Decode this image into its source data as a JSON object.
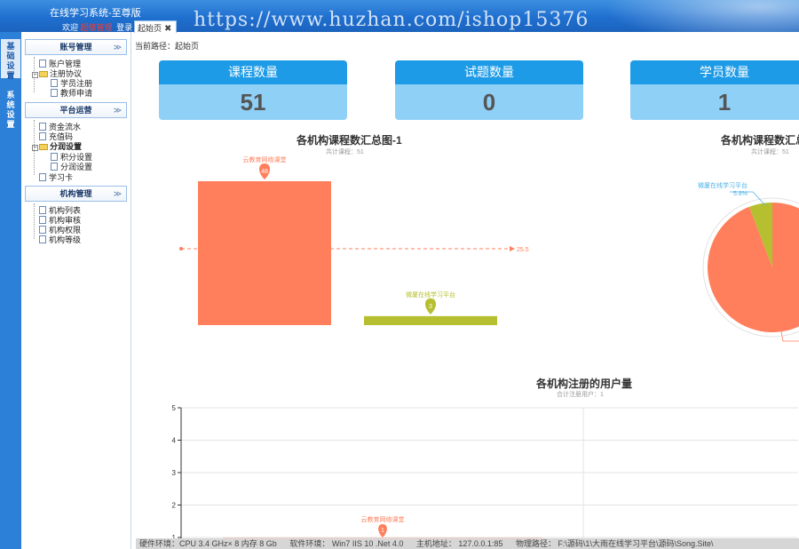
{
  "header": {
    "app_title": "在线学习系统-至尊版",
    "welcome_prefix": "欢迎",
    "admin_name": "超级管理",
    "login_label": "登录",
    "watermark": "https://www.huzhan.com/ishop15376"
  },
  "tabs": [
    {
      "label": "起始页",
      "close_icon": "close-icon"
    }
  ],
  "left_strip": {
    "items": [
      {
        "label": "基础设置",
        "active": true
      },
      {
        "label": "系统设置",
        "active": false
      }
    ]
  },
  "sidebar": {
    "panels": [
      {
        "title": "账号管理",
        "items": [
          "账户管理",
          "注册协议",
          "学员注册",
          "教师申请"
        ]
      },
      {
        "title": "平台运营",
        "items": [
          "资金流水",
          "充值码",
          "分润设置",
          "积分设置",
          "分润设置",
          "学习卡"
        ]
      },
      {
        "title": "机构管理",
        "items": [
          "机构列表",
          "机构审核",
          "机构权限",
          "机构等级"
        ]
      }
    ]
  },
  "breadcrumb": "当前路径：起始页",
  "stats": [
    {
      "label": "课程数量",
      "value": "51"
    },
    {
      "label": "试题数量",
      "value": "0"
    },
    {
      "label": "学员数量",
      "value": "1"
    }
  ],
  "colors": {
    "accent": "#1e9be6",
    "card_bottom": "#8fd0f7",
    "coral": "#ff7f5c",
    "olive": "#b5bf2f",
    "admin": "#ff3b30"
  },
  "charts": {
    "bar": {
      "title": "各机构课程数汇总图-1",
      "subtitle": "共计课程：51"
    },
    "pie": {
      "title": "各机构课程数汇总",
      "subtitle": "共计课程：51"
    },
    "line": {
      "title": "各机构注册的用户量",
      "subtitle": "合计注册用户：1"
    }
  },
  "chart_data": [
    {
      "type": "bar",
      "title": "各机构课程数汇总图-1",
      "subtitle": "共计课程：51",
      "categories": [
        "云教育网络课堂",
        "微厦在线学习平台"
      ],
      "values": [
        48,
        3
      ],
      "average_line": 25.5,
      "average_label": "25.5",
      "colors": [
        "#ff7f5c",
        "#b5bf2f"
      ]
    },
    {
      "type": "pie",
      "title": "各机构课程数汇总",
      "subtitle": "共计课程：51",
      "slices": [
        {
          "name": "云教育网络课堂",
          "value": 94.2
        },
        {
          "name": "微厦在线学习平台",
          "value": 5.8,
          "label": "5.8%"
        }
      ],
      "colors": [
        "#ff7f5c",
        "#b5bf2f"
      ]
    },
    {
      "type": "bar",
      "title": "各机构注册的用户量",
      "subtitle": "合计注册用户：1",
      "categories": [
        "云教育网络课堂"
      ],
      "values": [
        1
      ],
      "ylim": [
        1,
        5
      ],
      "yticks": [
        1,
        2,
        3,
        4,
        5
      ]
    }
  ],
  "footer": {
    "hardware": "硬件环境：CPU 3.4 GHz× 8 内存 8 Gb",
    "software": "软件环境： Win7 IIS 10 .Net 4.0",
    "host": "主机地址： 127.0.0.1:85",
    "path": "物理路径： F:\\源码\\1\\大雨在线学习平台\\源码\\Song.Site\\"
  }
}
